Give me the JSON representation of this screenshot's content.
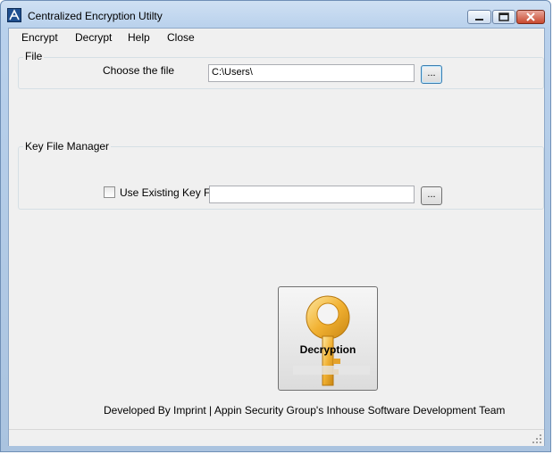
{
  "window": {
    "title": "Centralized Encryption Utilty"
  },
  "menu": {
    "items": [
      "Encrypt",
      "Decrypt",
      "Help",
      "Close"
    ]
  },
  "file_group": {
    "label": "File",
    "choose_label": "Choose the file",
    "path_value": "C:\\Users\\",
    "browse_label": "..."
  },
  "key_group": {
    "label": "Key File Manager",
    "checkbox_label": "Use Existing Key File",
    "checkbox_checked": false,
    "key_path_value": "",
    "browse_label": "..."
  },
  "action": {
    "decryption_label": "Decryption",
    "icon": "key-icon"
  },
  "footer": {
    "credits": "Developed By Imprint | Appin Security Group's Inhouse Software Development Team"
  },
  "colors": {
    "title_bar": "#b9d1ec",
    "client_bg": "#f0f0f0",
    "key_gold": "#f2b233"
  }
}
